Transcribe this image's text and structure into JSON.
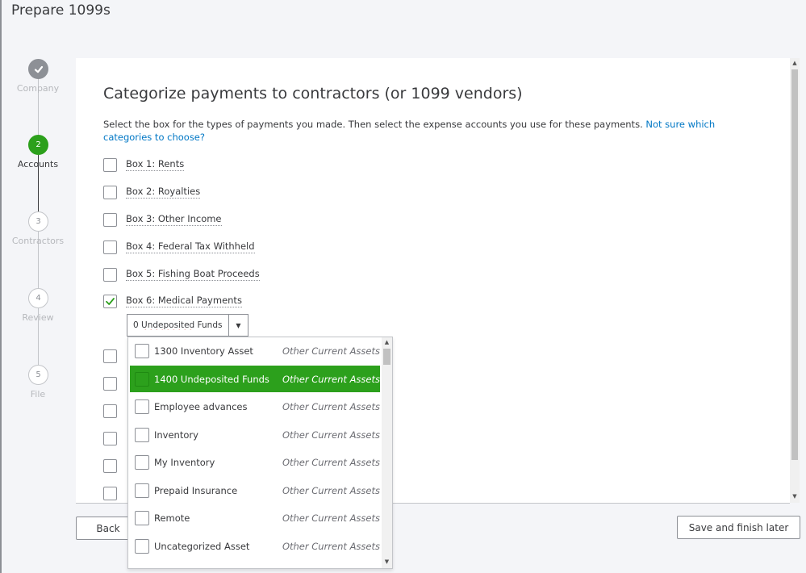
{
  "page": {
    "title": "Prepare 1099s"
  },
  "stepper": {
    "steps": [
      {
        "number": "",
        "label": "Company",
        "state": "done"
      },
      {
        "number": "2",
        "label": "Accounts",
        "state": "active"
      },
      {
        "number": "3",
        "label": "Contractors",
        "state": "upcoming"
      },
      {
        "number": "4",
        "label": "Review",
        "state": "upcoming"
      },
      {
        "number": "5",
        "label": "File",
        "state": "upcoming"
      }
    ]
  },
  "main": {
    "title": "Categorize payments to contractors (or 1099 vendors)",
    "description": "Select the box for the types of payments you made. Then select the expense accounts you use for these payments. ",
    "help_link": "Not sure which categories to choose?",
    "boxes": [
      {
        "label": "Box 1: Rents",
        "checked": false
      },
      {
        "label": "Box 2: Royalties",
        "checked": false
      },
      {
        "label": "Box 3: Other Income",
        "checked": false
      },
      {
        "label": "Box 4: Federal Tax Withheld",
        "checked": false
      },
      {
        "label": "Box 5: Fishing Boat Proceeds",
        "checked": false
      },
      {
        "label": "Box 6: Medical Payments",
        "checked": true
      }
    ],
    "account_select": {
      "value_prefix": "0 ",
      "value_word": "Undeposited",
      "value_suffix": " Funds"
    }
  },
  "dropdown": {
    "items": [
      {
        "name": "1300 Inventory Asset",
        "type": "Other Current Assets",
        "selected": false
      },
      {
        "name": "1400 Undeposited Funds",
        "type": "Other Current Assets",
        "selected": true
      },
      {
        "name": "Employee advances",
        "type": "Other Current Assets",
        "selected": false
      },
      {
        "name": "Inventory",
        "type": "Other Current Assets",
        "selected": false
      },
      {
        "name": "My Inventory",
        "type": "Other Current Assets",
        "selected": false
      },
      {
        "name": "Prepaid Insurance",
        "type": "Other Current Assets",
        "selected": false
      },
      {
        "name": "Remote",
        "type": "Other Current Assets",
        "selected": false
      },
      {
        "name": "Uncategorized Asset",
        "type": "Other Current Assets",
        "selected": false
      }
    ]
  },
  "footer": {
    "back_label": "Back",
    "save_label": "Save and finish later"
  },
  "colors": {
    "accent": "#2ca01c",
    "link": "#0077c5",
    "text": "#393a3d"
  }
}
